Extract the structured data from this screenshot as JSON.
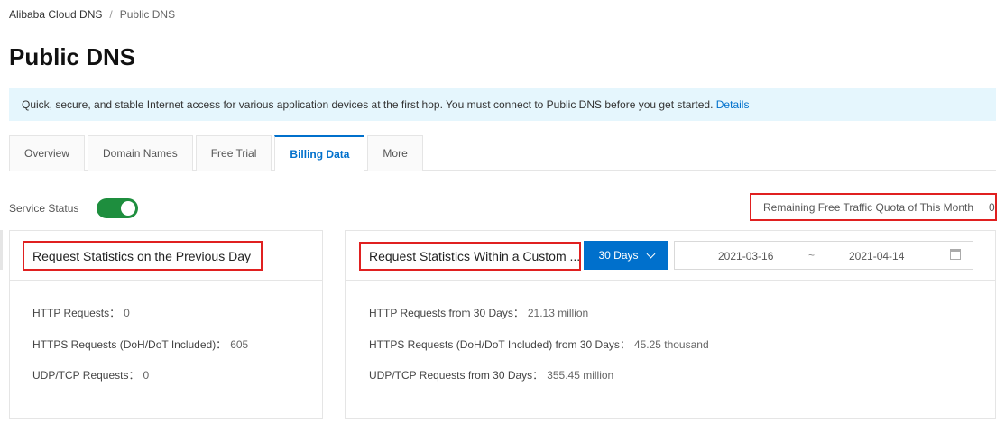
{
  "breadcrumb": {
    "root": "Alibaba Cloud DNS",
    "separator": "/",
    "current": "Public DNS"
  },
  "page_title": "Public DNS",
  "notice": {
    "text": "Quick, secure, and stable Internet access for various application devices at the first hop. You must connect to Public DNS before you get started.",
    "link": "Details"
  },
  "tabs": [
    {
      "label": "Overview",
      "active": false
    },
    {
      "label": "Domain Names",
      "active": false
    },
    {
      "label": "Free Trial",
      "active": false
    },
    {
      "label": "Billing Data",
      "active": true
    },
    {
      "label": "More",
      "active": false
    }
  ],
  "service_status": {
    "label": "Service Status",
    "enabled": true
  },
  "quota": {
    "label": "Remaining Free Traffic Quota of This Month",
    "value": "0"
  },
  "previous_day": {
    "title": "Request Statistics on the Previous Day",
    "stats": [
      {
        "label": "HTTP Requests：",
        "value": "0"
      },
      {
        "label": "HTTPS Requests (DoH/DoT Included)：",
        "value": "605"
      },
      {
        "label": "UDP/TCP Requests：",
        "value": "0"
      }
    ]
  },
  "custom_range": {
    "title": "Request Statistics Within a Custom ...",
    "period": "30 Days",
    "start_date": "2021-03-16",
    "tilde": "~",
    "end_date": "2021-04-14",
    "stats": [
      {
        "label": "HTTP Requests from 30 Days：",
        "value": "21.13 million"
      },
      {
        "label": "HTTPS Requests (DoH/DoT Included) from 30 Days：",
        "value": "45.25 thousand"
      },
      {
        "label": "UDP/TCP Requests from 30 Days：",
        "value": "355.45 million"
      }
    ]
  },
  "colors": {
    "accent": "#0070cc",
    "toggle_on": "#1e8e3e",
    "highlight_border": "#e02020",
    "notice_bg": "#e5f6fd"
  }
}
